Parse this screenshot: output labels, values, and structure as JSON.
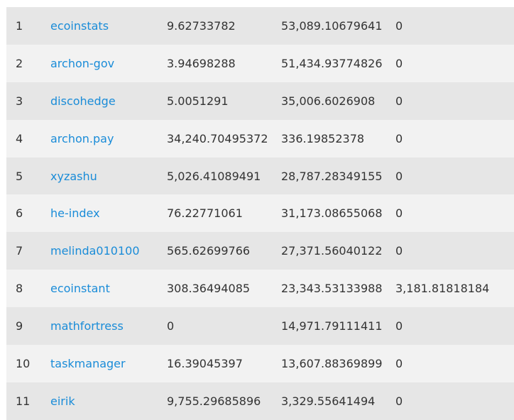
{
  "rows": [
    {
      "rank": "1",
      "account": "ecoinstats",
      "col_a": "9.62733782",
      "col_b": "53,089.10679641",
      "col_c": "0"
    },
    {
      "rank": "2",
      "account": "archon-gov",
      "col_a": "3.94698288",
      "col_b": "51,434.93774826",
      "col_c": "0"
    },
    {
      "rank": "3",
      "account": "discohedge",
      "col_a": "5.0051291",
      "col_b": "35,006.6026908",
      "col_c": "0"
    },
    {
      "rank": "4",
      "account": "archon.pay",
      "col_a": "34,240.70495372",
      "col_b": "336.19852378",
      "col_c": "0"
    },
    {
      "rank": "5",
      "account": "xyzashu",
      "col_a": "5,026.41089491",
      "col_b": "28,787.28349155",
      "col_c": "0"
    },
    {
      "rank": "6",
      "account": "he-index",
      "col_a": "76.22771061",
      "col_b": "31,173.08655068",
      "col_c": "0"
    },
    {
      "rank": "7",
      "account": "melinda010100",
      "col_a": "565.62699766",
      "col_b": "27,371.56040122",
      "col_c": "0"
    },
    {
      "rank": "8",
      "account": "ecoinstant",
      "col_a": "308.36494085",
      "col_b": "23,343.53133988",
      "col_c": "3,181.81818184"
    },
    {
      "rank": "9",
      "account": "mathfortress",
      "col_a": "0",
      "col_b": "14,971.79111411",
      "col_c": "0"
    },
    {
      "rank": "10",
      "account": "taskmanager",
      "col_a": "16.39045397",
      "col_b": "13,607.88369899",
      "col_c": "0"
    },
    {
      "rank": "11",
      "account": "eirik",
      "col_a": "9,755.29685896",
      "col_b": "3,329.55641494",
      "col_c": "0"
    }
  ],
  "colors": {
    "row_odd": "#e6e6e6",
    "row_even": "#f2f2f2",
    "link": "#1a8cd8",
    "text": "#333333"
  }
}
